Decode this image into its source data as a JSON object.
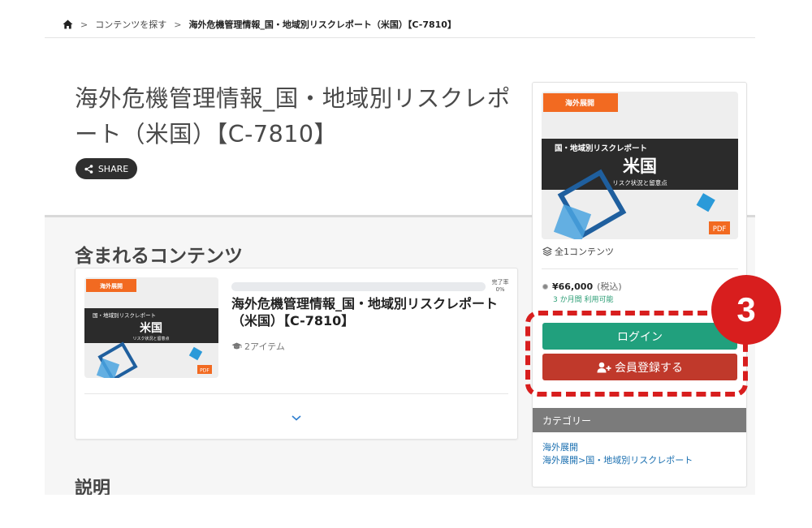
{
  "breadcrumb": {
    "home_icon": "home-icon",
    "separator": ">",
    "items": [
      "コンテンツを探す",
      "海外危機管理情報_国・地域別リスクレポート（米国）【C-7810】"
    ]
  },
  "product": {
    "title": "海外危機管理情報_国・地域別リスクレポート（米国）【C-7810】",
    "share_label": "SHARE"
  },
  "contents_section": {
    "title": "含まれるコンテンツ",
    "card": {
      "progress_label_line1": "完了率",
      "progress_label_line2": "0%",
      "progress_percent": 0,
      "title": "海外危機管理情報_国・地域別リスクレポート（米国）【C-7810】",
      "items_label": "2アイテム"
    }
  },
  "description_section": {
    "title": "説明"
  },
  "thumbnail": {
    "tag": "海外展開",
    "subtitle": "国・地域別リスクレポート",
    "country": "米国",
    "caption": "リスク状況と留意点",
    "pdf_label": "PDF"
  },
  "sidebar": {
    "contents_count": "全1コンテンツ",
    "price": "¥66,000",
    "tax_label": "(税込)",
    "period": "3 か月間 利用可能",
    "login_label": "ログイン",
    "register_label": "会員登録する",
    "category_header": "カテゴリー",
    "categories": [
      "海外展開",
      "海外展開>国・地域別リスクレポート"
    ]
  },
  "annotation": {
    "badge_number": "3"
  },
  "colors": {
    "login": "#21a07d",
    "register": "#c0392b",
    "annotation": "#d81e1e",
    "tag_orange": "#f26a21",
    "thumb_dark": "#2b2b2b",
    "thumb_blue": "#1f7bc8"
  }
}
